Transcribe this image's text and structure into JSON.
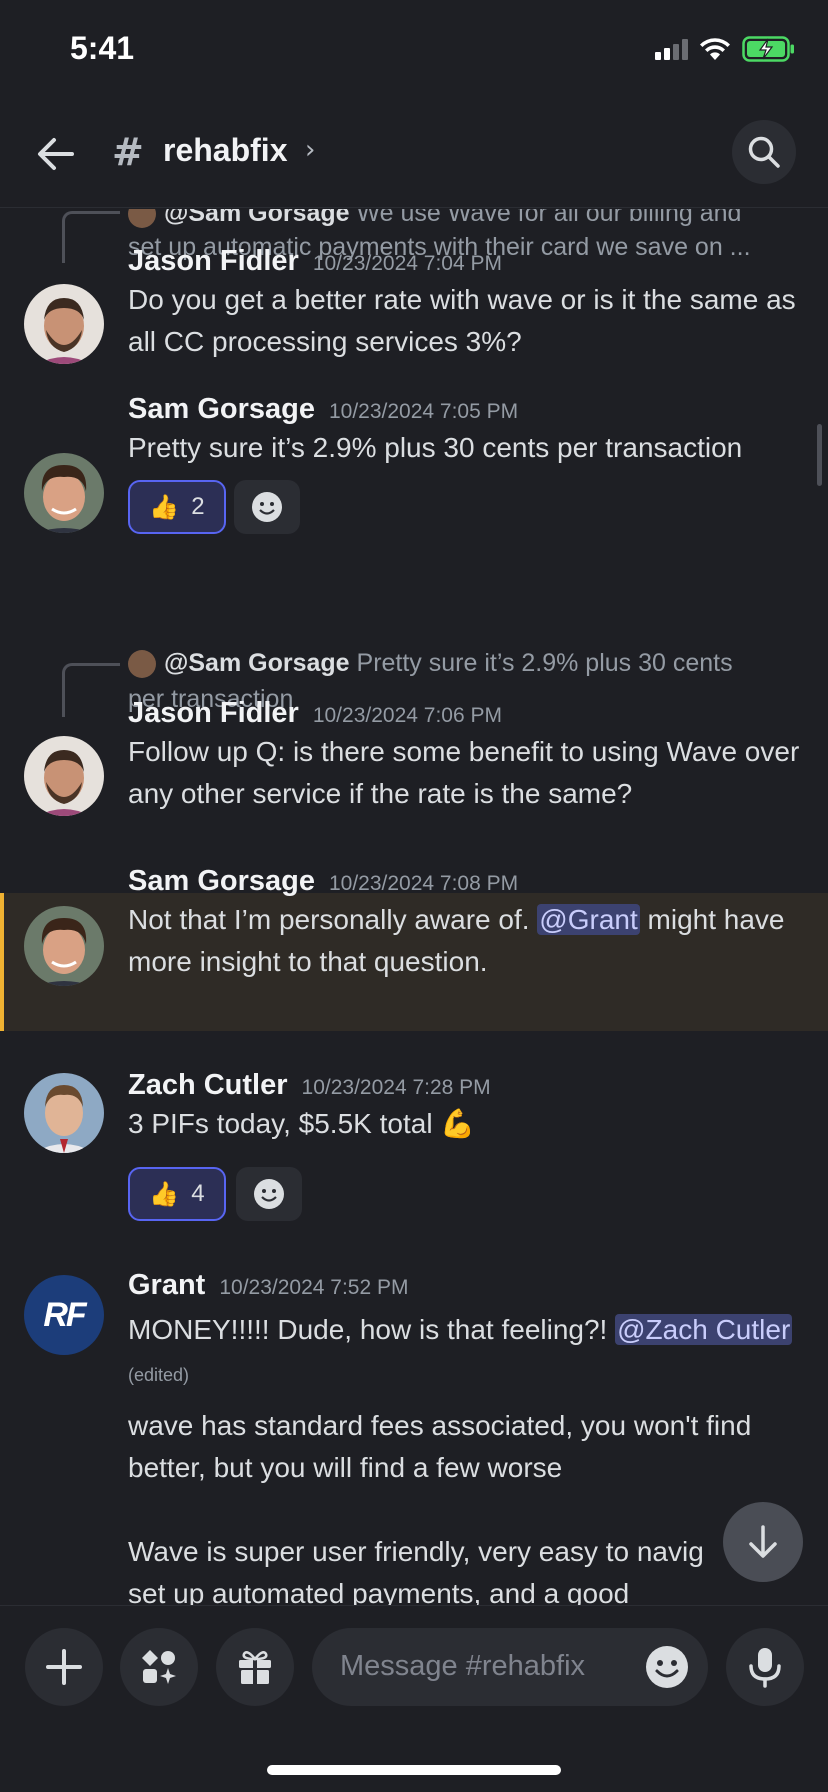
{
  "status_bar": {
    "time": "5:41"
  },
  "header": {
    "channel_name": "rehabfix"
  },
  "messages": [
    {
      "reply_to": {
        "author": "@Sam Gorsage",
        "text_line1": "We use Wave for all our billing and",
        "text_line2": "set up automatic payments with their card we save on ..."
      },
      "author": "Jason Fidler",
      "timestamp": "10/23/2024 7:04 PM",
      "text": "Do you get a better rate with wave or is it the same as all CC processing services 3%?"
    },
    {
      "author": "Sam Gorsage",
      "timestamp": "10/23/2024 7:05 PM",
      "text": "Pretty sure it’s 2.9% plus 30 cents per transaction",
      "reaction": {
        "emoji": "👍",
        "count": "2"
      }
    },
    {
      "reply_to": {
        "author": "@Sam Gorsage",
        "text_line1": "Pretty sure it’s 2.9% plus 30 cents",
        "text_line2": "per transaction"
      },
      "author": "Jason Fidler",
      "timestamp": "10/23/2024 7:06 PM",
      "text": "Follow up Q: is there some benefit to using Wave over any other service if the rate is the same?"
    },
    {
      "author": "Sam Gorsage",
      "timestamp": "10/23/2024 7:08 PM",
      "text_before": "Not that I’m personally aware of. ",
      "mention": "@Grant",
      "text_after": " might have more insight to that question."
    },
    {
      "author": "Zach Cutler",
      "timestamp": "10/23/2024 7:28 PM",
      "text": "3 PIFs today, $5.5K total 💪",
      "reaction": {
        "emoji": "👍",
        "count": "4"
      }
    },
    {
      "author": "Grant",
      "avatar_text": "RF",
      "timestamp": "10/23/2024 7:52 PM",
      "text_before": "MONEY!!!!! Dude, how is that feeling?! ",
      "mention": "@Zach Cutler",
      "edited": "(edited)",
      "text2": "wave has standard fees associated, you won't find better, but you will find a few worse",
      "text3": "Wave is super user friendly, very easy to navig",
      "text4": "set up automated payments, and a good"
    }
  ],
  "composer": {
    "placeholder": "Message #rehabfix"
  },
  "colors": {
    "accent": "#5865f2",
    "mention_bg": "#3c4270",
    "highlight_bar": "#f0b232",
    "background": "#1e1f24"
  }
}
